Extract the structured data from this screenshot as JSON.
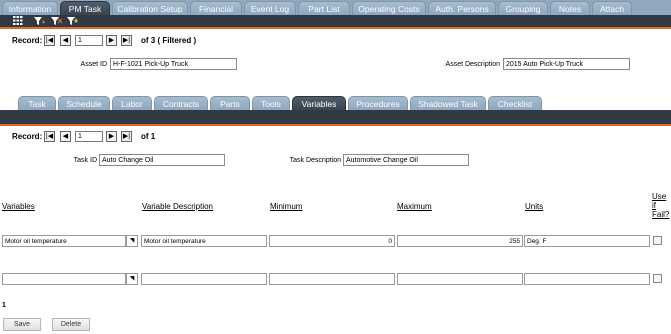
{
  "top_tabs": [
    {
      "label": "Information",
      "active": false
    },
    {
      "label": "PM Task",
      "active": true
    },
    {
      "label": "Calibration Setup",
      "active": false
    },
    {
      "label": "Financial",
      "active": false
    },
    {
      "label": "Event Log",
      "active": false
    },
    {
      "label": "Part List",
      "active": false
    },
    {
      "label": "Operating Costs",
      "active": false
    },
    {
      "label": "Auth. Persons",
      "active": false
    },
    {
      "label": "Grouping",
      "active": false
    },
    {
      "label": "Notes",
      "active": false
    },
    {
      "label": "Attach",
      "active": false
    }
  ],
  "toolbar": {
    "icons": [
      "grid-icon",
      "filter-add-icon",
      "filter-remove-icon",
      "filter-star-icon"
    ]
  },
  "record1": {
    "label": "Record:",
    "value": "1",
    "of_text": "of 3 ( Filtered )"
  },
  "asset": {
    "id_label": "Asset ID",
    "id_value": "H-F-1021 Pick-Up Truck",
    "desc_label": "Asset Description",
    "desc_value": "2015 Auto Pick-Up Truck"
  },
  "sub_tabs": [
    {
      "label": "Task",
      "active": false
    },
    {
      "label": "Schedule",
      "active": false
    },
    {
      "label": "Labor",
      "active": false
    },
    {
      "label": "Contracts",
      "active": false
    },
    {
      "label": "Parts",
      "active": false
    },
    {
      "label": "Tools",
      "active": false
    },
    {
      "label": "Variables",
      "active": true
    },
    {
      "label": "Procedures",
      "active": false
    },
    {
      "label": "Shadowed Task",
      "active": false
    },
    {
      "label": "Checklist",
      "active": false
    }
  ],
  "record2": {
    "label": "Record:",
    "value": "1",
    "of_text": "of 1"
  },
  "task": {
    "id_label": "Task ID",
    "id_value": "Auto Change Oil",
    "desc_label": "Task Description",
    "desc_value": "Automotive Change Oil"
  },
  "columns": {
    "variables": "Variables",
    "variable_description": "Variable Description",
    "minimum": "Minimum",
    "maximum": "Maximum",
    "units": "Units",
    "use_if_fail_1": "Use",
    "use_if_fail_2": "if",
    "use_if_fail_3": "Fail?"
  },
  "rows": [
    {
      "variable": "Motor oil temperature",
      "description": "Motor oil temperature",
      "minimum": "0",
      "maximum": "255",
      "units": "Deg. F"
    },
    {
      "variable": "",
      "description": "",
      "minimum": "",
      "maximum": "",
      "units": ""
    }
  ],
  "row_count": "1",
  "buttons": {
    "save": "Save",
    "delete": "Delete"
  },
  "colors": {
    "tab_bg": "#8ea7bd",
    "active_tab": "#38434e",
    "accent": "#e06a2a",
    "band": "#2f3a45"
  }
}
